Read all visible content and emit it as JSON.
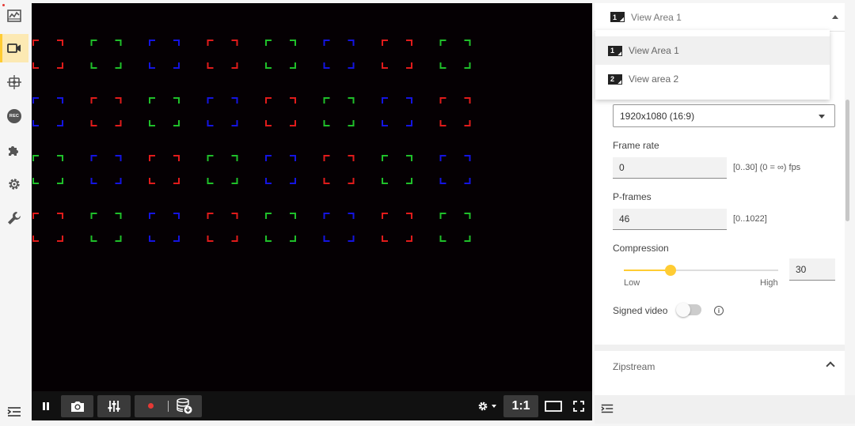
{
  "nav": {
    "items": [
      {
        "id": "status",
        "icon": "activity-chart-icon"
      },
      {
        "id": "video",
        "icon": "video-camera-icon",
        "active": true
      },
      {
        "id": "ptz",
        "icon": "ptz-move-icon"
      },
      {
        "id": "recordings",
        "icon": "rec-icon",
        "badge": "REC"
      },
      {
        "id": "apps",
        "icon": "puzzle-icon"
      },
      {
        "id": "system",
        "icon": "gear-icon"
      },
      {
        "id": "maintenance",
        "icon": "wrench-icon"
      }
    ],
    "collapse_icon": "menu-collapse-icon"
  },
  "player": {
    "zoom_label": "1:1",
    "marker_colors": {
      "red": "#e01b1b",
      "green": "#1fbf2a",
      "blue": "#1414e0"
    },
    "marker_grid": [
      [
        "red",
        "green",
        "blue",
        "red",
        "green",
        "blue",
        "red",
        "green"
      ],
      [
        "blue",
        "red",
        "green",
        "blue",
        "red",
        "green",
        "blue",
        "red"
      ],
      [
        "green",
        "blue",
        "red",
        "green",
        "blue",
        "red",
        "green",
        "blue"
      ],
      [
        "red",
        "green",
        "blue",
        "red",
        "green",
        "blue",
        "red",
        "green"
      ]
    ]
  },
  "panel": {
    "view_area": {
      "current": "View Area 1",
      "current_number": "1",
      "options": [
        {
          "number": "1",
          "label": "View Area 1"
        },
        {
          "number": "2",
          "label": "View area 2"
        }
      ]
    },
    "resolution": {
      "value": "1920x1080 (16:9)"
    },
    "frame_rate": {
      "label": "Frame rate",
      "value": "0",
      "hint": "[0..30] (0 = ∞) fps"
    },
    "p_frames": {
      "label": "P-frames",
      "value": "46",
      "hint": "[0..1022]"
    },
    "compression": {
      "label": "Compression",
      "value": "30",
      "fraction": 0.3,
      "low_label": "Low",
      "high_label": "High"
    },
    "signed_video": {
      "label": "Signed video",
      "enabled": false
    },
    "zipstream": {
      "label": "Zipstream"
    }
  },
  "colors": {
    "accent": "#ffcc33",
    "video_bg": "#050003",
    "toolbar_bg": "#111111"
  }
}
